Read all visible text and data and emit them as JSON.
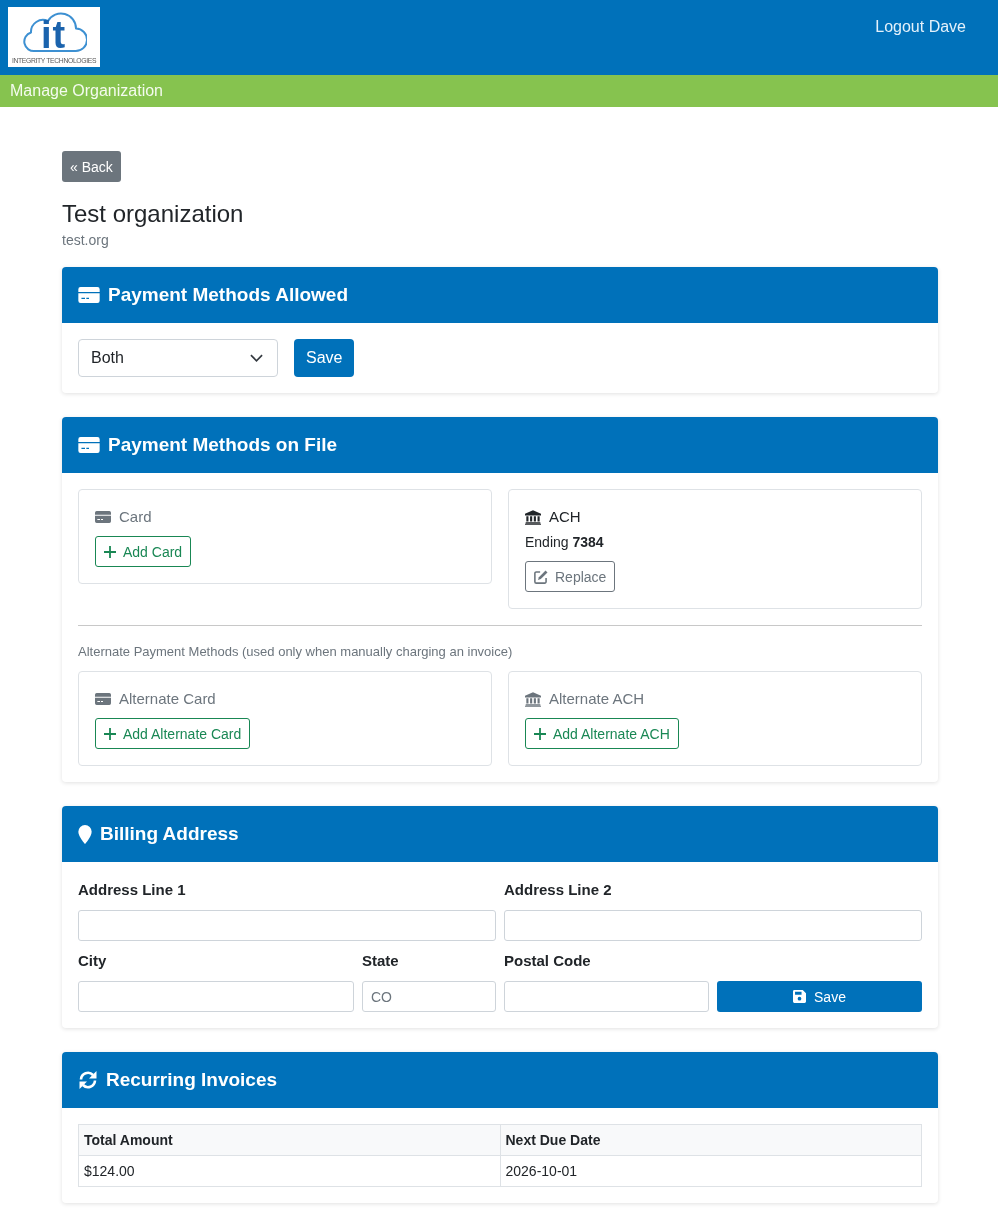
{
  "header": {
    "logo": {
      "letters": "it",
      "tagline": "INTEGRITY TECHNOLOGIES"
    },
    "logout_link": "Logout Dave"
  },
  "nav_bar": {
    "title": "Manage Organization"
  },
  "back_button": "« Back",
  "organization": {
    "name": "Test organization",
    "domain": "test.org"
  },
  "payment_methods_allowed": {
    "title": "Payment Methods Allowed",
    "select_value": "Both",
    "save_button": "Save"
  },
  "payment_methods_on_file": {
    "title": "Payment Methods on File",
    "primary": [
      {
        "kind": "card",
        "label": "Card",
        "on_file": false,
        "action": {
          "kind": "add",
          "label": "Add Card"
        }
      },
      {
        "kind": "bank",
        "label": "ACH",
        "on_file": true,
        "detail": "Ending **7384**",
        "action": {
          "kind": "replace",
          "label": "Replace"
        }
      }
    ],
    "alternate_note": "Alternate Payment Methods (used only when manually charging an invoice)",
    "alternate": [
      {
        "kind": "card",
        "label": "Alternate Card",
        "on_file": false,
        "action": {
          "kind": "add",
          "label": "Add Alternate Card"
        }
      },
      {
        "kind": "bank",
        "label": "Alternate ACH",
        "on_file": false,
        "action": {
          "kind": "add",
          "label": "Add Alternate ACH"
        }
      }
    ]
  },
  "billing_address": {
    "title": "Billing Address",
    "fields": [
      {
        "label": "Address Line 1"
      },
      {
        "label": "Address Line 2"
      },
      {
        "label": "City"
      },
      {
        "label": "State",
        "placeholder": "CO"
      },
      {
        "label": "Postal Code"
      }
    ],
    "save_button": "Save"
  },
  "recurring_invoices": {
    "title": "Recurring Invoices",
    "table": {
      "columns": [
        "Total Amount",
        "Next Due Date"
      ],
      "rows": [
        [
          "$124.00",
          "2026-10-01"
        ]
      ]
    }
  }
}
